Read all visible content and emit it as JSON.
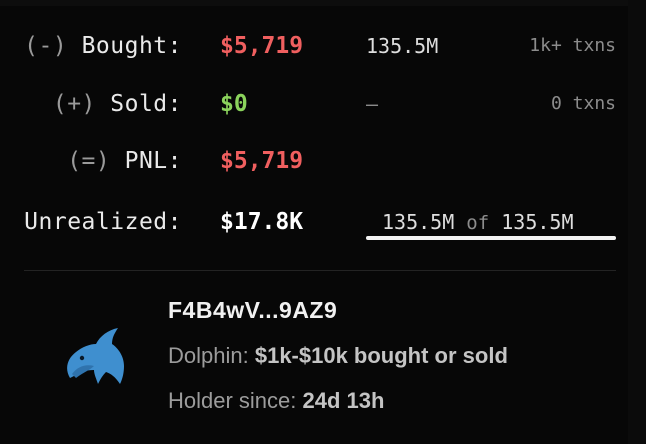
{
  "colors": {
    "negative": "#f05f5f",
    "positive": "#8bd35c",
    "neutral": "#ffffff",
    "dolphin": "#3f8fcf"
  },
  "summary": {
    "bought": {
      "prefix": "(-)",
      "label": "Bought:",
      "amount": "$5,719",
      "tokens": "135.5M",
      "txns": "1k+ txns"
    },
    "sold": {
      "prefix": "(+)",
      "label": "Sold:",
      "amount": "$0",
      "tokens": "—",
      "txns": "0 txns"
    },
    "pnl": {
      "prefix": "(=)",
      "label": "PNL:",
      "amount": "$5,719"
    },
    "unrealized": {
      "label": "Unrealized:",
      "amount": "$17.8K",
      "held": "135.5M",
      "of": "of",
      "total": "135.5M",
      "held_fraction": 1.0
    }
  },
  "holder": {
    "icon": "dolphin-icon",
    "address": "F4B4wV...9AZ9",
    "tier_label": "Dolphin:",
    "tier_value": "$1k-$10k bought or sold",
    "since_label": "Holder since:",
    "since_value": "24d 13h"
  }
}
